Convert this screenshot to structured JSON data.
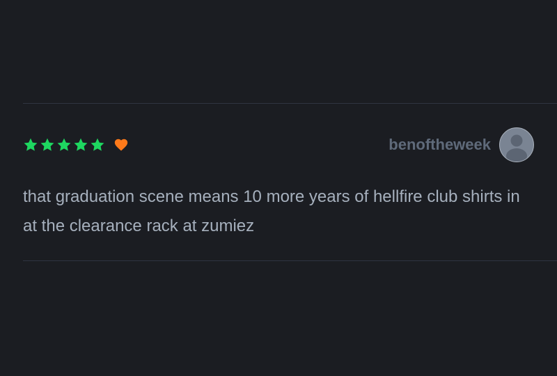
{
  "review": {
    "rating": 5,
    "rating_max": 5,
    "liked": true,
    "username": "benoftheweek",
    "text": "that graduation scene means 10 more years of hellfire club shirts in at the clearance rack at zumiez"
  },
  "colors": {
    "background": "#1b1d22",
    "star": "#1ed760",
    "heart": "#ff7a1a",
    "username": "#5f6a7a",
    "body_text": "#a6b0bd",
    "divider": "#2f3541"
  },
  "icons": {
    "star": "star-icon",
    "heart": "heart-icon",
    "avatar": "default-avatar-icon"
  }
}
